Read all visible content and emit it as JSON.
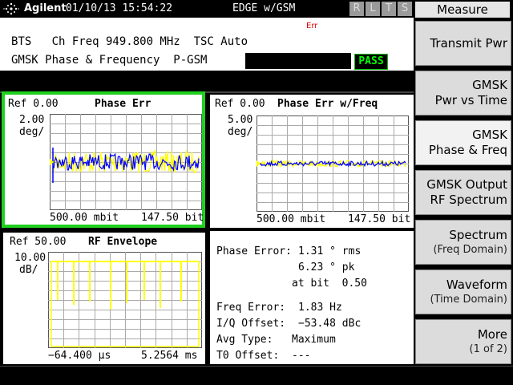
{
  "header": {
    "brand": "Agilent",
    "datetime": "01/10/13 15:54:22",
    "mode": "EDGE w/GSM",
    "indicators": [
      "R",
      "L",
      "T",
      "S"
    ]
  },
  "info": {
    "err_tag": "Err",
    "line1": "BTS   Ch Freq 949.800 MHz  TSC Auto",
    "line2": "GMSK Phase & Frequency  P-GSM",
    "pass": "PASS"
  },
  "panels": {
    "phase_err": {
      "ref": "Ref 0.00",
      "title": "Phase Err",
      "scale": "2.00",
      "unit": "deg/",
      "x_start": "500.00 mbit",
      "x_stop": "147.50 bit"
    },
    "phase_err_freq": {
      "ref": "Ref 0.00",
      "title": "Phase Err w/Freq",
      "scale": "5.00",
      "unit": "deg/",
      "x_start": "500.00 mbit",
      "x_stop": "147.50 bit"
    },
    "rf_envelope": {
      "ref": "Ref 50.00",
      "title": "RF Envelope",
      "scale": "10.00",
      "unit": "dB/",
      "x_start": "−64.400 µs",
      "x_stop": "5.2564 ms"
    }
  },
  "metrics": {
    "phase_error_label": "Phase Error:",
    "phase_error_rms": "1.31 ° rms",
    "phase_error_pk": "6.23 ° pk",
    "at_bit": "at bit  0.50",
    "freq_error_label": "Freq Error:",
    "freq_error_value": "1.83 Hz",
    "iq_offset_label": "I/Q Offset:",
    "iq_offset_value": "−53.48 dBc",
    "avg_type_label": "Avg Type:",
    "avg_type_value": "Maximum",
    "t0_offset_label": "T0 Offset:",
    "t0_offset_value": "---"
  },
  "softkeys": {
    "title": "Measure",
    "items": [
      {
        "line1": "Transmit Pwr",
        "line2": ""
      },
      {
        "line1": "GMSK",
        "line2": "Pwr vs Time"
      },
      {
        "line1": "GMSK",
        "line2": "Phase & Freq"
      },
      {
        "line1": "GMSK Output",
        "line2": "RF Spectrum"
      },
      {
        "line1": "Spectrum",
        "line2": "(Freq Domain)"
      },
      {
        "line1": "Waveform",
        "line2": "(Time Domain)"
      },
      {
        "line1": "More",
        "line2": "(1 of 2)"
      }
    ]
  },
  "colors": {
    "trace_yellow": "#ffff00",
    "trace_blue": "#0000ff",
    "pass_green": "#00ff00",
    "active_frame": "#1fd01f",
    "err_red": "#e00000"
  }
}
